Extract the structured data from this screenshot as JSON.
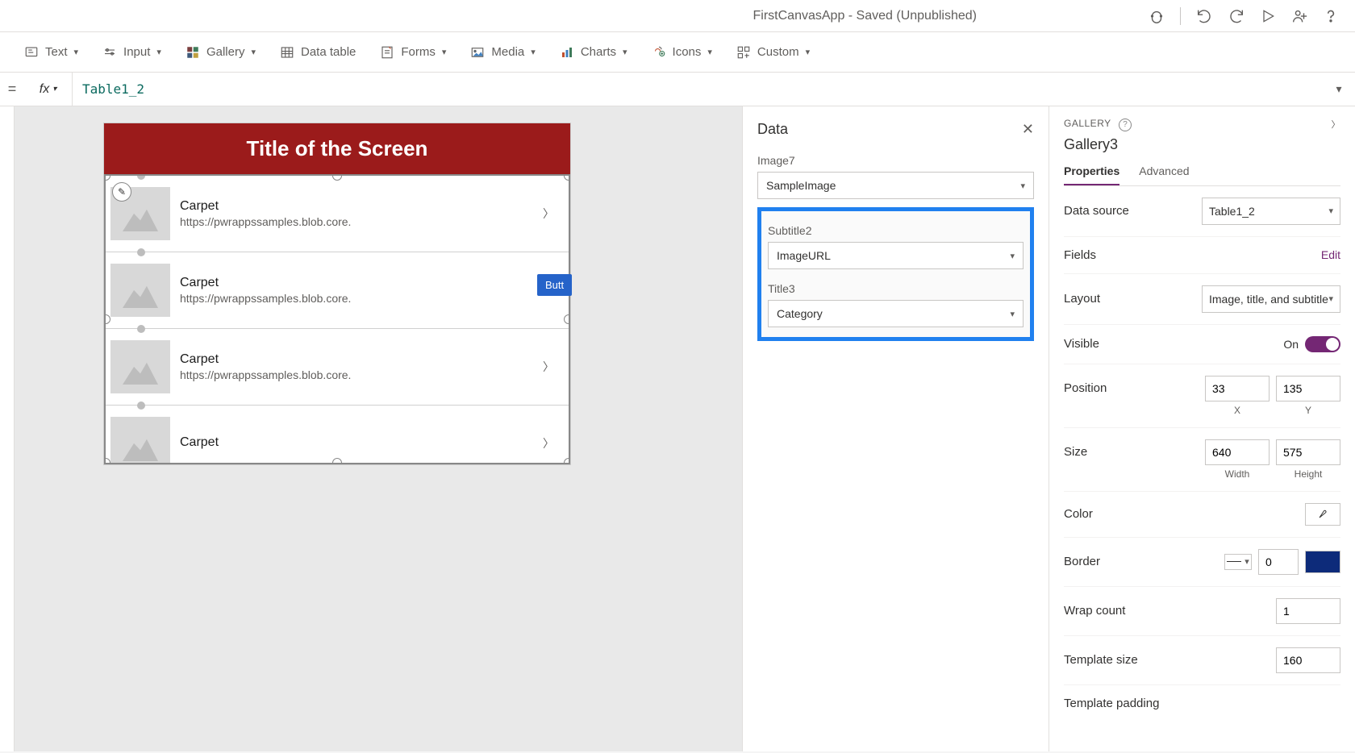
{
  "titlebar": {
    "app_title": "FirstCanvasApp - Saved (Unpublished)"
  },
  "ribbon": {
    "items": [
      {
        "label": "Text"
      },
      {
        "label": "Input"
      },
      {
        "label": "Gallery"
      },
      {
        "label": "Data table"
      },
      {
        "label": "Forms"
      },
      {
        "label": "Media"
      },
      {
        "label": "Charts"
      },
      {
        "label": "Icons"
      },
      {
        "label": "Custom"
      }
    ]
  },
  "formula": {
    "value": "Table1_2"
  },
  "canvas": {
    "screen_title": "Title of the Screen",
    "button_label": "Butt",
    "gallery_items": [
      {
        "title": "Carpet",
        "subtitle": "https://pwrappssamples.blob.core."
      },
      {
        "title": "Carpet",
        "subtitle": "https://pwrappssamples.blob.core."
      },
      {
        "title": "Carpet",
        "subtitle": "https://pwrappssamples.blob.core."
      },
      {
        "title": "Carpet",
        "subtitle": ""
      }
    ]
  },
  "data_panel": {
    "title": "Data",
    "fields": [
      {
        "label": "Image7",
        "value": "SampleImage"
      },
      {
        "label": "Subtitle2",
        "value": "ImageURL"
      },
      {
        "label": "Title3",
        "value": "Category"
      }
    ]
  },
  "props": {
    "section": "GALLERY",
    "name": "Gallery3",
    "tabs": {
      "properties": "Properties",
      "advanced": "Advanced"
    },
    "data_source_label": "Data source",
    "data_source_value": "Table1_2",
    "fields_label": "Fields",
    "fields_edit": "Edit",
    "layout_label": "Layout",
    "layout_value": "Image, title, and subtitle",
    "visible_label": "Visible",
    "visible_value": "On",
    "position_label": "Position",
    "position_x": "33",
    "position_y": "135",
    "position_x_label": "X",
    "position_y_label": "Y",
    "size_label": "Size",
    "size_w": "640",
    "size_h": "575",
    "size_w_label": "Width",
    "size_h_label": "Height",
    "color_label": "Color",
    "border_label": "Border",
    "border_width": "0",
    "wrap_label": "Wrap count",
    "wrap_value": "1",
    "template_size_label": "Template size",
    "template_size_value": "160",
    "template_padding_label": "Template padding"
  }
}
